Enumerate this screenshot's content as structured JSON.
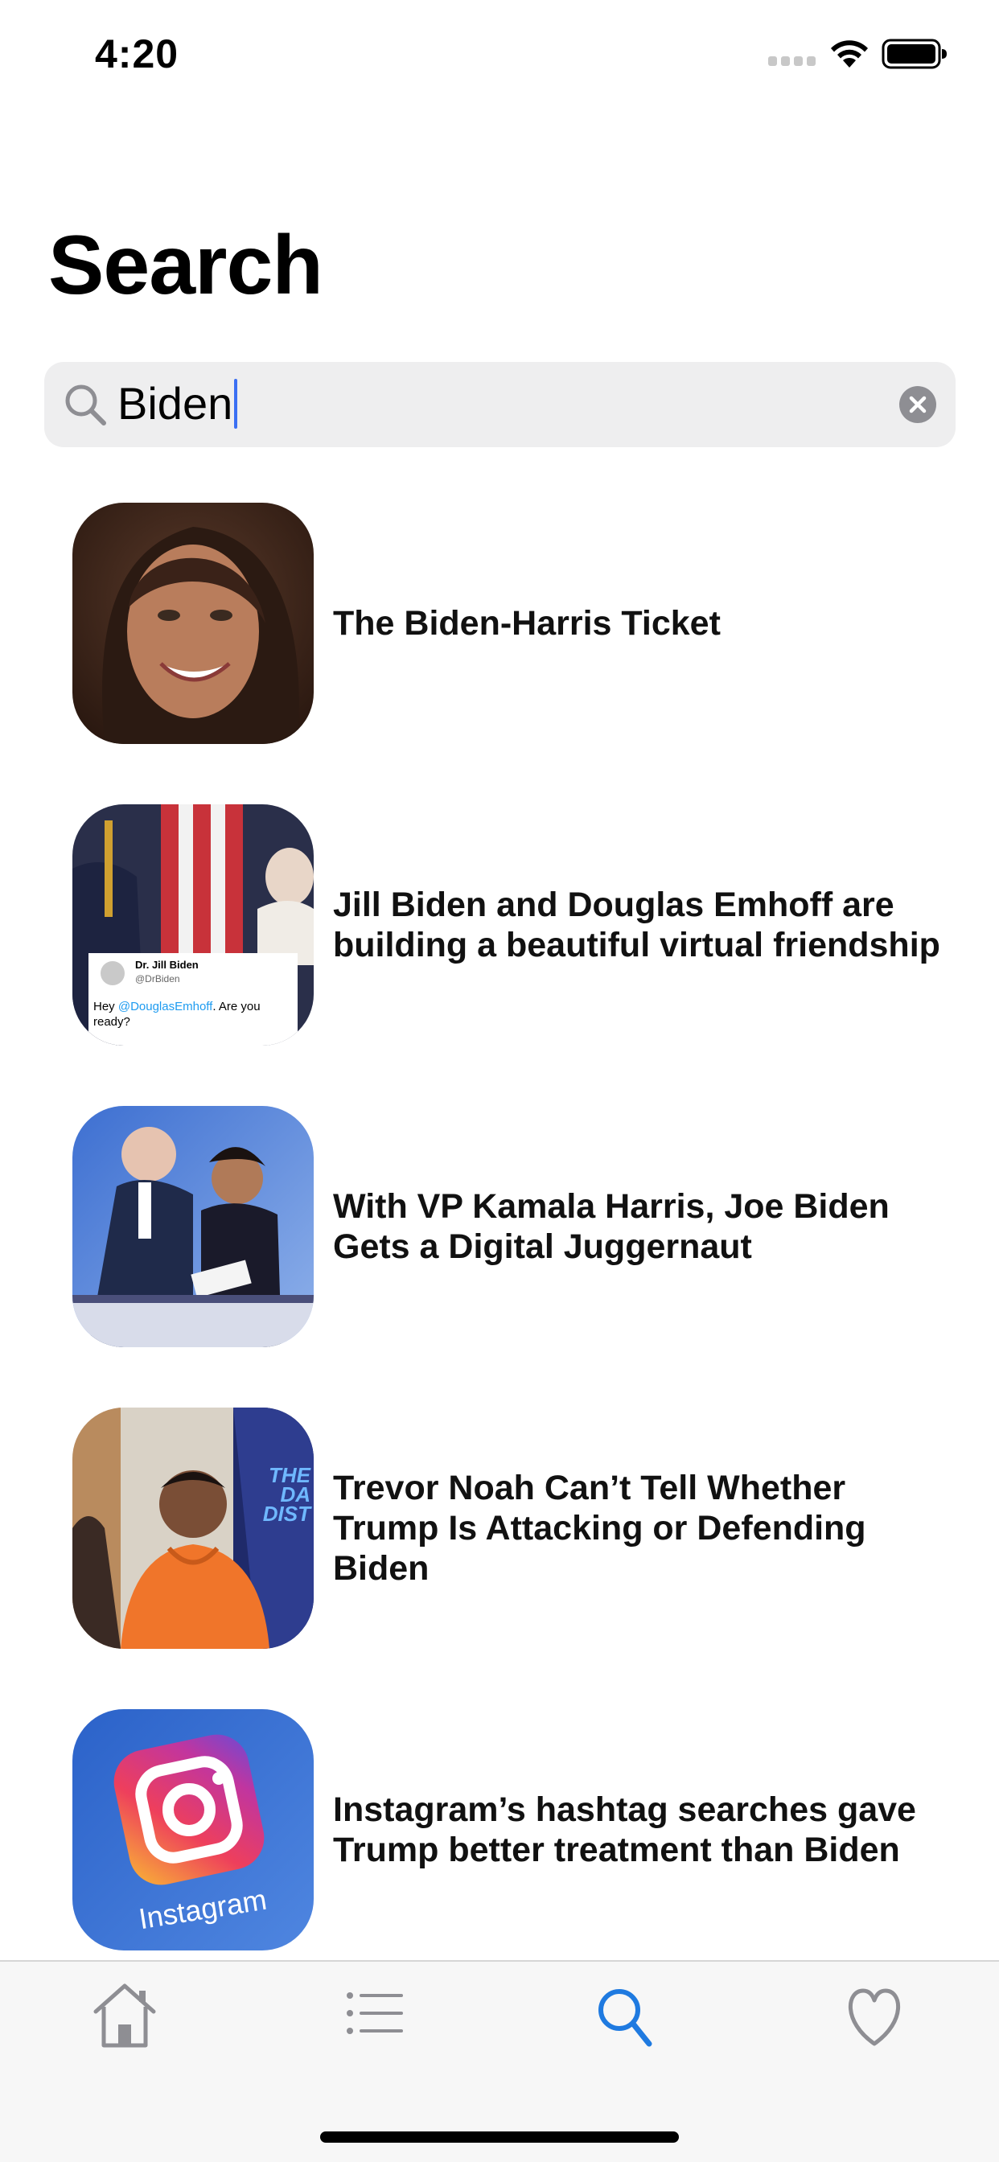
{
  "status_bar": {
    "time": "4:20"
  },
  "page": {
    "title": "Search"
  },
  "search": {
    "value": "Biden"
  },
  "results": [
    {
      "title": "The Biden-Harris Ticket"
    },
    {
      "title": "Jill Biden and Douglas Emhoff are building a beautiful virtual friendship",
      "thumb_tweet": {
        "name": "Dr. Jill Biden",
        "handle": "@DrBiden",
        "text_prefix": "Hey ",
        "mention": "@DouglasEmhoff",
        "text_suffix": ". Are you ready?"
      }
    },
    {
      "title": "With VP Kamala Harris, Joe Biden Gets a Digital Juggernaut"
    },
    {
      "title": "Trevor Noah Can’t Tell Whether Trump Is Attacking or Defending Biden",
      "thumb_sign": "THE DA DIST"
    },
    {
      "title": "Instagram’s hashtag searches gave Trump better treatment than Biden",
      "thumb_logo_text": "Instagram"
    }
  ],
  "tab_bar": {
    "active_tab": "search",
    "tabs": [
      {
        "id": "home",
        "icon": "home-icon"
      },
      {
        "id": "list",
        "icon": "list-icon"
      },
      {
        "id": "search",
        "icon": "search-icon"
      },
      {
        "id": "favorites",
        "icon": "heart-icon"
      }
    ]
  },
  "colors": {
    "accent": "#1f7ae0",
    "inactive_tab": "#8e8e93",
    "caret": "#3b6ff3"
  }
}
